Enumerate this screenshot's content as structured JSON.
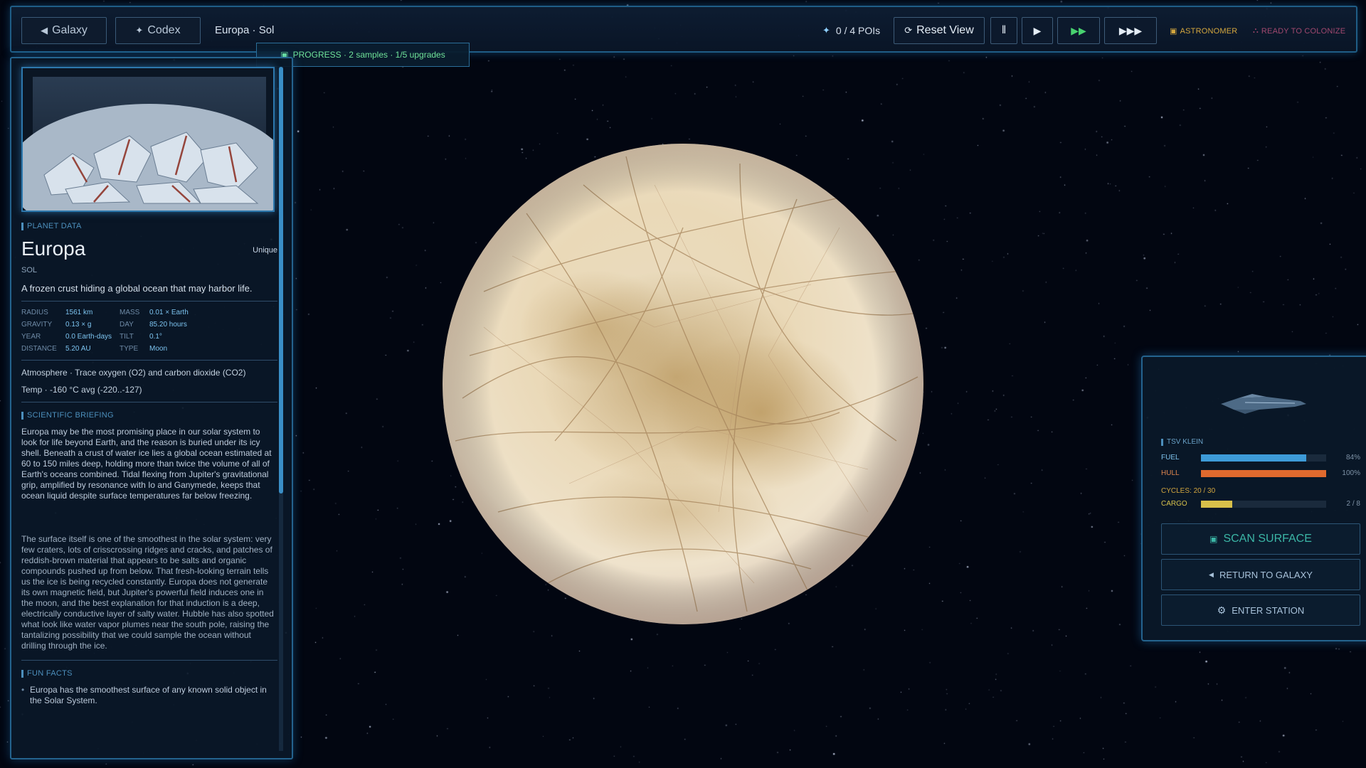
{
  "topbar": {
    "galaxy_label": "Galaxy",
    "codex_label": "Codex",
    "location": "Europa · Sol",
    "pois": "0 / 4 POIs",
    "reset_label": "Reset View",
    "pause_glyph": "‖",
    "play_glyph": "▶",
    "fast_glyph": "▶▶",
    "faster_glyph": "▶▶▶",
    "rank_badge": "ASTRONOMER",
    "status_badge": "READY TO COLONIZE"
  },
  "progress": {
    "text": "PROGRESS · 2 samples · 1/5 upgrades"
  },
  "planet": {
    "section_label": "PLANET DATA",
    "name": "Europa",
    "rarity": "Unique",
    "system": "SOL",
    "tagline": "A frozen crust hiding a global ocean that may harbor life.",
    "stats": {
      "radius_k": "RADIUS",
      "radius_v": "1561 km",
      "mass_k": "MASS",
      "mass_v": "0.01 × Earth",
      "gravity_k": "GRAVITY",
      "gravity_v": "0.13 × g",
      "day_k": "DAY",
      "day_v": "85.20 hours",
      "year_k": "YEAR",
      "year_v": "0.0 Earth-days",
      "tilt_k": "TILT",
      "tilt_v": "0.1°",
      "distance_k": "DISTANCE",
      "distance_v": "5.20 AU",
      "type_k": "TYPE",
      "type_v": "Moon"
    },
    "atmosphere": "Atmosphere · Trace oxygen (O2) and carbon dioxide (CO2)",
    "temp": "Temp · -160 °C avg (-220..-127)",
    "briefing_label": "SCIENTIFIC BRIEFING",
    "briefing_p1": "Europa may be the most promising place in our solar system to look for life beyond Earth, and the reason is buried under its icy shell. Beneath a crust of water ice lies a global ocean estimated at 60 to 150 miles deep, holding more than twice the volume of all of Earth's oceans combined. Tidal flexing from Jupiter's gravitational grip, amplified by resonance with Io and Ganymede, keeps that ocean liquid despite surface temperatures far below freezing.",
    "briefing_p2": "The surface itself is one of the smoothest in the solar system: very few craters, lots of crisscrossing ridges and cracks, and patches of reddish-brown material that appears to be salts and organic compounds pushed up from below. That fresh-looking terrain tells us the ice is being recycled constantly. Europa does not generate its own magnetic field, but Jupiter's powerful field induces one in the moon, and the best explanation for that induction is a deep, electrically conductive layer of salty water. Hubble has also spotted what look like water vapor plumes near the south pole, raising the tantalizing possibility that we could sample the ocean without drilling through the ice.",
    "facts_label": "FUN FACTS",
    "fact_1": "Europa has the smoothest surface of any known solid object in the Solar System."
  },
  "ship": {
    "name": "TSV KLEIN",
    "fuel_label": "FUEL",
    "fuel_pct": "84%",
    "fuel_level": 0.84,
    "hull_label": "HULL",
    "hull_pct": "100%",
    "hull_level": 1.0,
    "cycles": "CYCLES: 20 / 30",
    "cargo_label": "CARGO",
    "cargo_count": "2 / 8",
    "cargo_level": 0.25,
    "scan_label": "SCAN SURFACE",
    "return_label": "RETURN TO GALAXY",
    "station_label": "ENTER STATION"
  },
  "colors": {
    "fuel": "#3d9bd8",
    "hull": "#e06a2e",
    "cargo": "#d8c04a",
    "accent": "#24638e",
    "progress_text": "#6fe39a"
  }
}
